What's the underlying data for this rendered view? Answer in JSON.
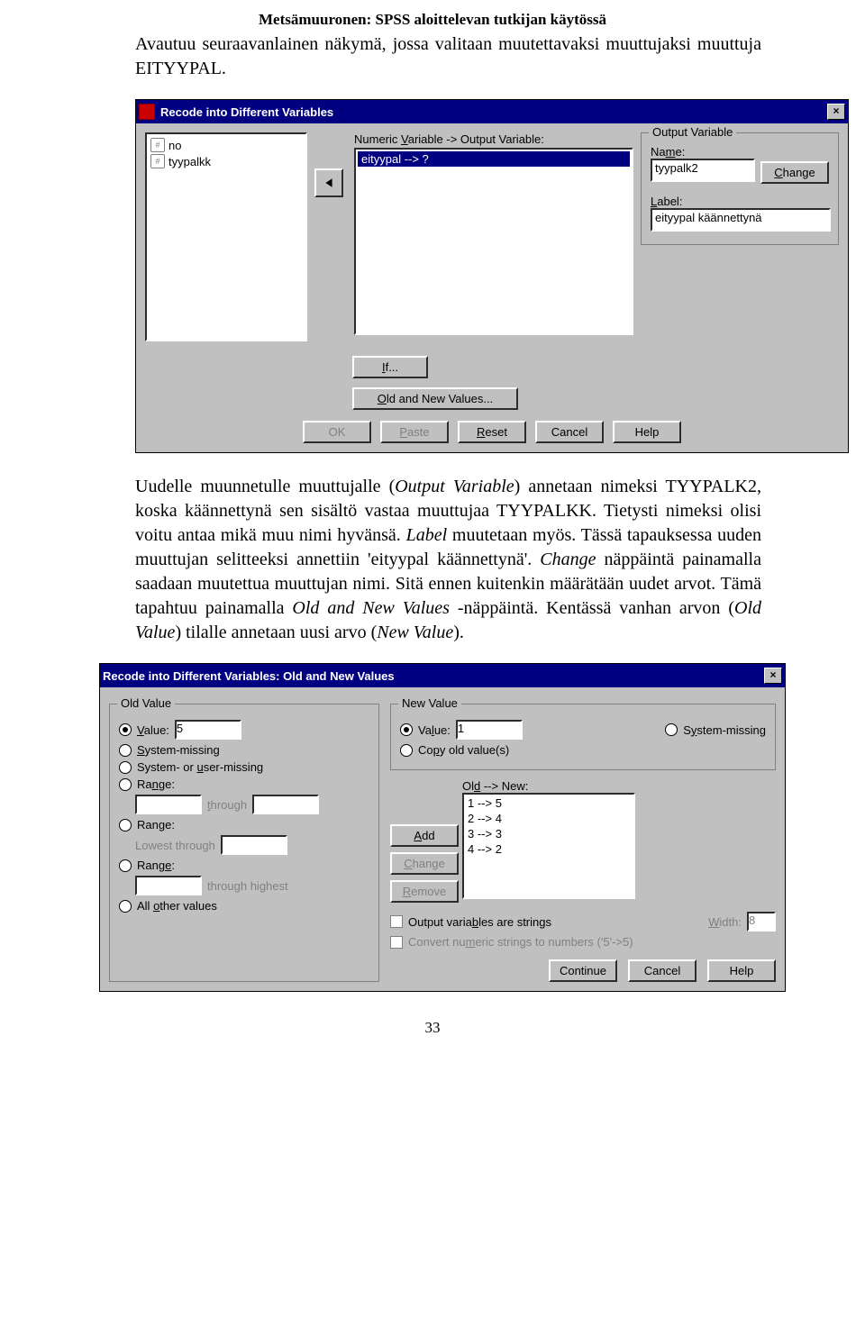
{
  "header": "Metsämuuronen: SPSS   aloittelevan tutkijan käytössä",
  "para1": "Avautuu seuraavanlainen näkymä, jossa valitaan muutettavaksi muuttujaksi muuttuja EITYYPAL.",
  "para2_a": "Uudelle muunnetulle muuttujalle (",
  "para2_b": "Output Variable",
  "para2_c": ") annetaan nimeksi TYYPALK2, koska käännettynä sen sisältö vastaa muuttujaa TYYPALKK. Tietysti nimeksi olisi voitu antaa mikä muu nimi hyvänsä. ",
  "para2_d": "Label",
  "para2_e": " muutetaan myös. Tässä tapauksessa uuden muuttujan selitteeksi annettiin 'eityypal käännettynä'. ",
  "para2_f": "Change",
  "para2_g": " näppäintä painamalla saadaan muutettua muuttujan nimi. Sitä ennen kuitenkin määrätään uudet arvot. Tämä tapahtuu painamalla ",
  "para2_h": "Old and New Values",
  "para2_i": " -näppäintä. Kentässä vanhan arvon (",
  "para2_j": "Old Value",
  "para2_k": ") tilalle annetaan uusi arvo (",
  "para2_l": "New Value",
  "para2_m": ").",
  "page_no": "33",
  "d1": {
    "title": "Recode into Different Variables",
    "src_items": [
      "no",
      "tyypalkk"
    ],
    "numeric_label": "Numeric Variable -> Output Variable:",
    "selected": "eityypal --> ?",
    "group_title": "Output Variable",
    "name_label": "Name:",
    "name_value": "tyypalk2",
    "change": "Change",
    "label_label": "Label:",
    "label_value": "eityypal käännettynä",
    "if": "If...",
    "oldnew": "Old and New Values...",
    "ok": "OK",
    "paste": "Paste",
    "reset": "Reset",
    "cancel": "Cancel",
    "help": "Help"
  },
  "d2": {
    "title": "Recode into Different Variables: Old and New Values",
    "old_group": "Old Value",
    "value": "Value:",
    "old_value_input": "5",
    "sysmiss": "System-missing",
    "sysusermiss": "System- or user-missing",
    "range": "Range:",
    "through": "through",
    "range2": "Range:",
    "lowest": "Lowest through",
    "range3": "Range:",
    "highest": "through highest",
    "allother": "All other values",
    "new_group": "New Value",
    "new_value": "Value:",
    "new_value_input": "1",
    "new_sysmiss": "System-missing",
    "copyold": "Copy old value(s)",
    "oldnew_label": "Old --> New:",
    "mappings": [
      "1 --> 5",
      "2 --> 4",
      "3 --> 3",
      "4 --> 2"
    ],
    "add": "Add",
    "change": "Change",
    "remove": "Remove",
    "strings_cb": "Output variables are strings",
    "width": "Width:",
    "width_val": "8",
    "convert_cb": "Convert numeric strings to numbers ('5'->5)",
    "continue": "Continue",
    "cancel": "Cancel",
    "help": "Help"
  }
}
